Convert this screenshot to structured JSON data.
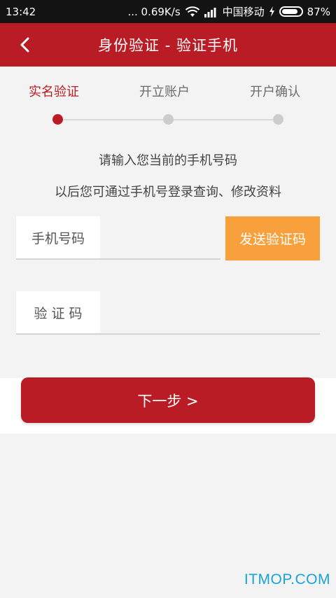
{
  "status_bar": {
    "time": "13:42",
    "speed": "... 0.69K/s",
    "carrier": "中国移动",
    "battery": "87%",
    "battery_level": 0.87
  },
  "header": {
    "title": "身份验证 - 验证手机"
  },
  "steps": [
    {
      "label": "实名验证",
      "active": true
    },
    {
      "label": "开立账户",
      "active": false
    },
    {
      "label": "开户确认",
      "active": false
    }
  ],
  "hints": {
    "line1": "请输入您当前的手机号码",
    "line2": "以后您可通过手机号登录查询、修改资料"
  },
  "form": {
    "phone_label": "手机号码",
    "phone_value": "",
    "send_code_label": "发送验证码",
    "code_label": "验 证 码",
    "code_value": ""
  },
  "next_button_label": "下一步 >",
  "watermark": "ITMOP.COM",
  "colors": {
    "brand_red": "#b91c24",
    "send_orange": "#f7a03c",
    "watermark_blue": "#1aa3d6"
  }
}
